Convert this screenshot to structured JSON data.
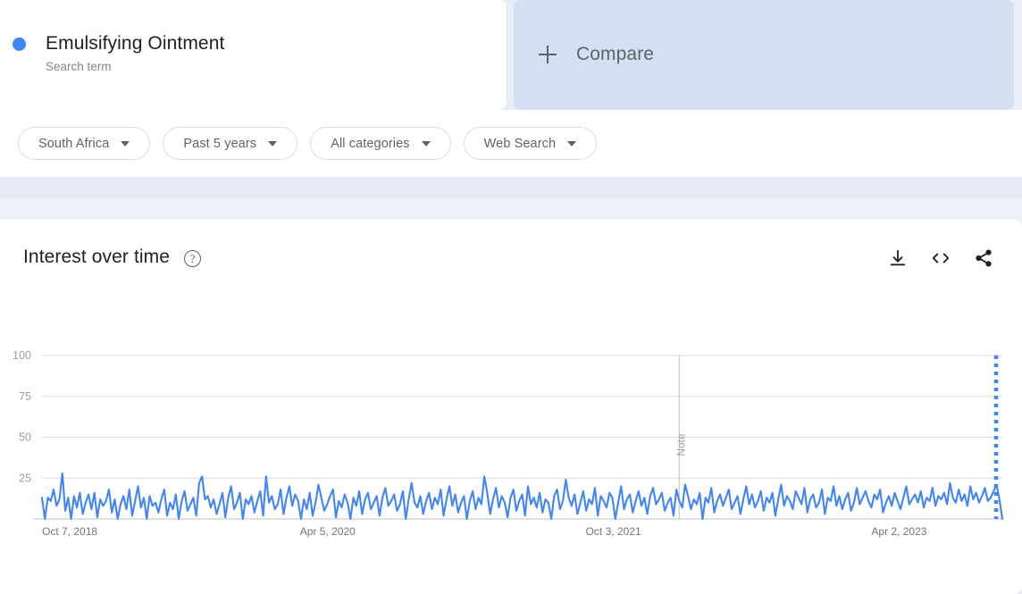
{
  "search_term": {
    "title": "Emulsifying Ointment",
    "subtitle": "Search term",
    "color": "#4285f4"
  },
  "compare": {
    "label": "Compare",
    "plus_icon": "plus-icon",
    "background": "#d2e0f2"
  },
  "filters": [
    {
      "label": "South Africa",
      "icon": "chevron-down-icon"
    },
    {
      "label": "Past 5 years",
      "icon": "chevron-down-icon"
    },
    {
      "label": "All categories",
      "icon": "chevron-down-icon"
    },
    {
      "label": "Web Search",
      "icon": "chevron-down-icon"
    }
  ],
  "chart_panel": {
    "title": "Interest over time",
    "help_icon": "help-circle-icon",
    "help_glyph": "?",
    "actions": [
      {
        "name": "download-icon",
        "tooltip": "Download"
      },
      {
        "name": "embed-code-icon",
        "tooltip": "Embed"
      },
      {
        "name": "share-icon",
        "tooltip": "Share"
      }
    ]
  },
  "chart_data": {
    "type": "line",
    "title": "Interest over time",
    "xlabel": "",
    "ylabel": "",
    "ylim": [
      0,
      100
    ],
    "yticks": [
      100,
      75,
      50,
      25
    ],
    "xticks": [
      "Oct 7, 2018",
      "Apr 5, 2020",
      "Oct 3, 2021",
      "Apr 2, 2023"
    ],
    "xtick_positions": [
      0,
      0.2975,
      0.595,
      0.8925
    ],
    "grid": true,
    "legend": "Emulsifying Ointment",
    "line_color": "#4285f4",
    "annotations": [
      {
        "label": "Note",
        "x_fraction": 0.6635,
        "type": "vertical-line",
        "orientation": "vertical-text"
      }
    ],
    "partial_data_marker": {
      "label": "",
      "x_fraction": 0.9935,
      "style": "dotted-vertical",
      "color": "#4285f4"
    },
    "series": [
      {
        "name": "Emulsifying Ointment",
        "values": [
          13,
          0,
          13,
          11,
          18,
          8,
          12,
          28,
          5,
          13,
          0,
          14,
          7,
          16,
          3,
          10,
          15,
          6,
          16,
          1,
          12,
          8,
          11,
          18,
          4,
          12,
          0,
          9,
          14,
          6,
          18,
          2,
          11,
          20,
          7,
          13,
          0,
          14,
          8,
          10,
          4,
          12,
          18,
          2,
          10,
          6,
          15,
          0,
          11,
          17,
          5,
          9,
          13,
          2,
          22,
          26,
          12,
          14,
          7,
          12,
          3,
          9,
          16,
          1,
          13,
          20,
          6,
          10,
          16,
          0,
          12,
          9,
          14,
          4,
          11,
          17,
          2,
          26,
          10,
          14,
          6,
          9,
          18,
          3,
          13,
          20,
          8,
          15,
          11,
          0,
          12,
          6,
          16,
          2,
          10,
          21,
          13,
          5,
          9,
          14,
          18,
          1,
          11,
          7,
          15,
          10,
          0,
          13,
          8,
          17,
          3,
          12,
          16,
          6,
          10,
          14,
          2,
          13,
          19,
          8,
          11,
          15,
          5,
          9,
          17,
          0,
          12,
          22,
          10,
          7,
          14,
          3,
          11,
          16,
          6,
          13,
          9,
          18,
          2,
          12,
          20,
          8,
          15,
          4,
          10,
          14,
          0,
          11,
          17,
          6,
          13,
          9,
          26,
          16,
          3,
          12,
          19,
          7,
          14,
          10,
          1,
          13,
          18,
          5,
          11,
          15,
          2,
          20,
          9,
          13,
          7,
          16,
          4,
          12,
          10,
          0,
          14,
          18,
          6,
          11,
          24,
          13,
          8,
          15,
          3,
          10,
          17,
          5,
          12,
          9,
          19,
          2,
          14,
          11,
          7,
          16,
          13,
          0,
          10,
          20,
          6,
          12,
          15,
          4,
          11,
          17,
          8,
          13,
          3,
          14,
          19,
          9,
          12,
          16,
          5,
          10,
          13,
          2,
          18,
          11,
          7,
          21,
          14,
          6,
          12,
          9,
          16,
          0,
          13,
          10,
          19,
          4,
          11,
          15,
          8,
          13,
          18,
          6,
          10,
          14,
          3,
          12,
          20,
          9,
          15,
          7,
          11,
          17,
          5,
          13,
          10,
          16,
          2,
          12,
          21,
          8,
          14,
          11,
          6,
          17,
          13,
          9,
          19,
          4,
          12,
          15,
          7,
          10,
          18,
          3,
          13,
          11,
          20,
          8,
          14,
          6,
          12,
          16,
          5,
          10,
          19,
          9,
          13,
          17,
          11,
          7,
          15,
          12,
          18,
          4,
          10,
          14,
          8,
          16,
          11,
          6,
          13,
          20,
          9,
          12,
          15,
          10,
          17,
          7,
          13,
          11,
          19,
          8,
          14,
          12,
          16,
          9,
          22,
          13,
          10,
          18,
          11,
          15,
          8,
          20,
          12,
          16,
          10,
          14,
          19,
          11,
          13,
          17,
          21,
          12,
          0
        ]
      }
    ]
  }
}
